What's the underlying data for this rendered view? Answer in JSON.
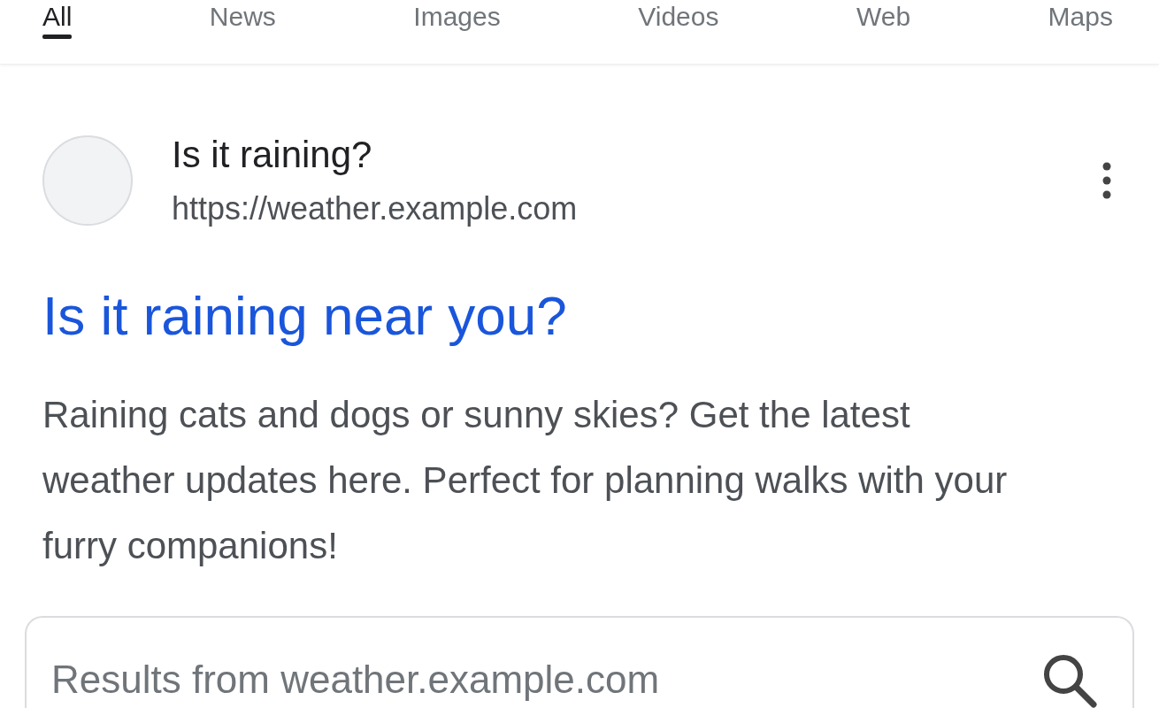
{
  "tabs": [
    {
      "label": "All",
      "selected": true
    },
    {
      "label": "News",
      "selected": false
    },
    {
      "label": "Images",
      "selected": false
    },
    {
      "label": "Videos",
      "selected": false
    },
    {
      "label": "Web",
      "selected": false
    },
    {
      "label": "Maps",
      "selected": false
    }
  ],
  "result": {
    "site_name": "Is it raining?",
    "url": "https://weather.example.com",
    "title": "Is it raining near you?",
    "snippet": "Raining cats and dogs or sunny skies? Get the latest weather updates here. Perfect for planning walks with your furry companions!"
  },
  "site_search": {
    "placeholder": "Results from weather.example.com"
  }
}
